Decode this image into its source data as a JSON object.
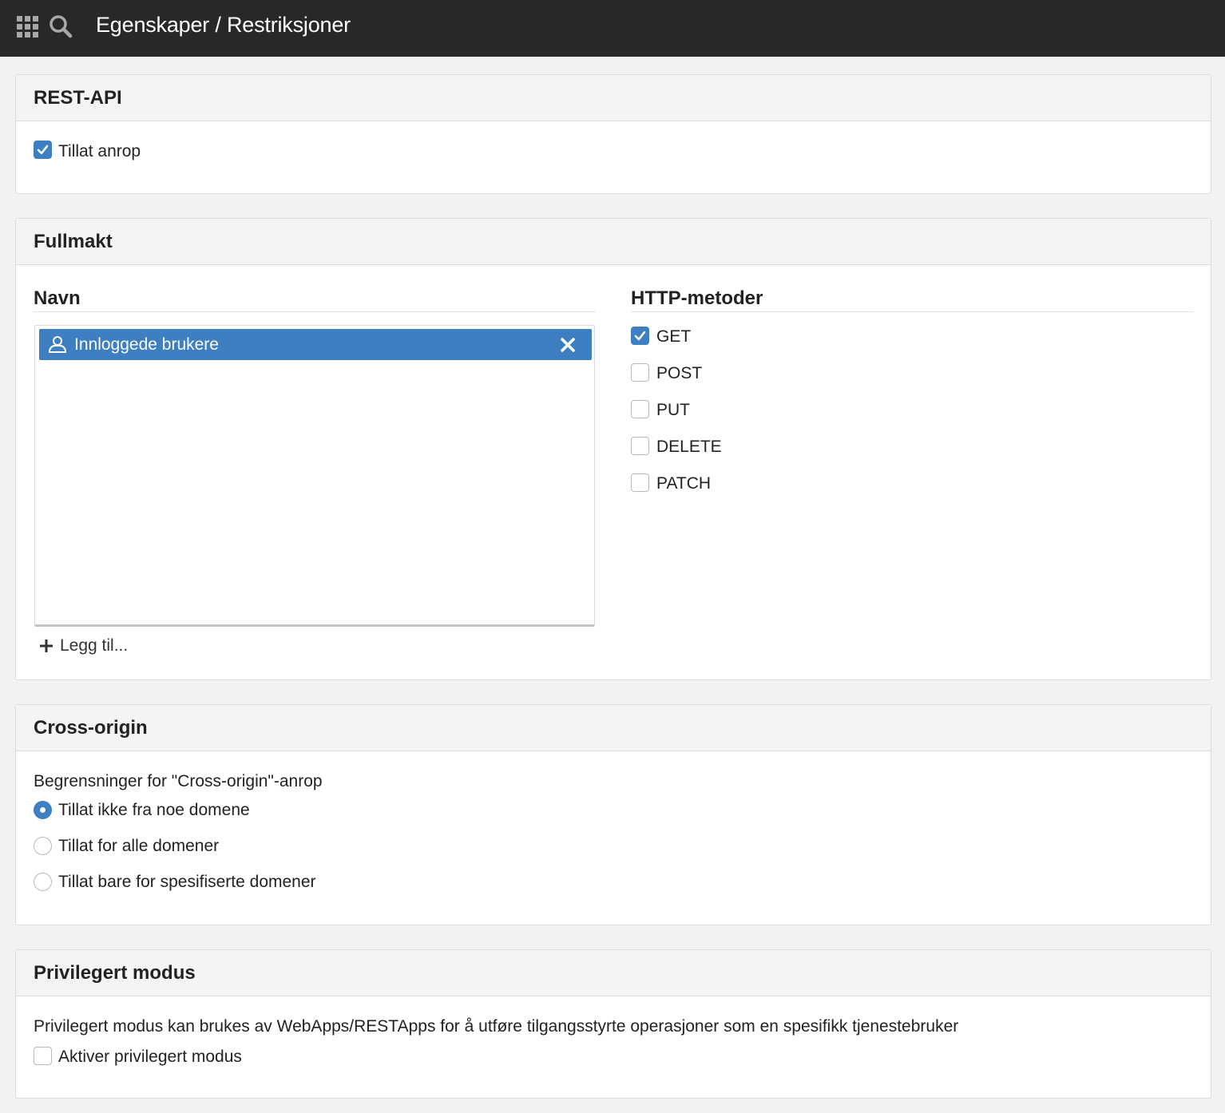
{
  "header": {
    "breadcrumb": "Egenskaper / Restriksjoner",
    "apps_icon": "apps-grid-icon",
    "search_icon": "search-icon"
  },
  "rest_api": {
    "title": "REST-API",
    "allow_calls": {
      "label": "Tillat anrop",
      "checked": true
    }
  },
  "fullmakt": {
    "title": "Fullmakt",
    "names_title": "Navn",
    "names": [
      {
        "label": "Innloggede brukere",
        "icon": "user-icon"
      }
    ],
    "add_label": "Legg til...",
    "methods_title": "HTTP-metoder",
    "methods": [
      {
        "label": "GET",
        "checked": true
      },
      {
        "label": "POST",
        "checked": false
      },
      {
        "label": "PUT",
        "checked": false
      },
      {
        "label": "DELETE",
        "checked": false
      },
      {
        "label": "PATCH",
        "checked": false
      }
    ]
  },
  "cross_origin": {
    "title": "Cross-origin",
    "description": "Begrensninger for \"Cross-origin\"-anrop",
    "options": [
      {
        "label": "Tillat ikke fra noe domene",
        "selected": true
      },
      {
        "label": "Tillat for alle domener",
        "selected": false
      },
      {
        "label": "Tillat bare for spesifiserte domener",
        "selected": false
      }
    ]
  },
  "privileged": {
    "title": "Privilegert modus",
    "description": "Privilegert modus kan brukes av WebApps/RESTApps for å utføre tilgangsstyrte operasjoner som en spesifikk tjenestebruker",
    "enable": {
      "label": "Aktiver privilegert modus",
      "checked": false
    }
  },
  "colors": {
    "topbar": "#282828",
    "accent": "#3d7fc1",
    "panel_header": "#f4f4f4"
  }
}
